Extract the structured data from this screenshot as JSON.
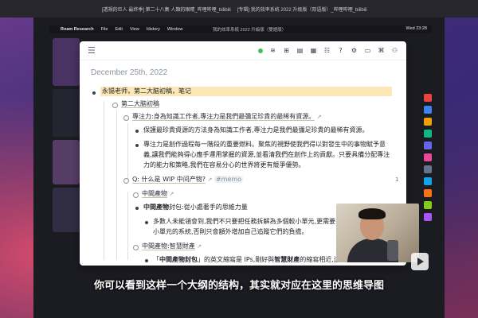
{
  "browser_tabs": [
    "[透視的巨人 最终季] 第二十八集 人類的眼睛_哔哩哔哩_bilibili",
    "[专辑] 我的效率系统 2022 升级版（双语版）_哔哩哔哩_bilibili"
  ],
  "menubar": {
    "apple": "",
    "app_name": "Roam Research",
    "items": [
      "File",
      "Edit",
      "View",
      "History",
      "Window"
    ],
    "window_title": "我的效率系統 2022 升級版（雙語版）",
    "clock": "Wed 23:28"
  },
  "roam": {
    "menu_icon": "☰",
    "tools": [
      "≋",
      "⊞",
      "▤",
      "▦",
      "☷",
      "?",
      "⚙",
      "▭",
      "⌘",
      "⚇"
    ],
    "date_title": "December 25th, 2022",
    "blocks": {
      "root": "永锡老师，第二大脑初稿，笔记",
      "l1": "第二大脑初稿",
      "l2a_ref": "專注力:身為知識工作者,專注力是我們最彌足珍貴的最稀有資源。",
      "l2a_arrow": "↗",
      "l3a": "保護最珍貴資源的方法身為知識工作者,專注力是我們最彌足珍貴的最稀有資源。",
      "l3b_line1": "專注力是創作過程每一階段的重要燃料。聚焦的視野使我們得以對發生中的事物賦予意",
      "l3b_line2": "義,讓我們能夠得心應手運用掌握的資源,並看清我們在創作上的貢獻。只要具備分配專注",
      "l3b_line3": "力的能力和策略,我們在容易分心的世界將更有競爭優勢。",
      "l2b": "Q: 什么是 WIP 中间产物?",
      "l2b_arrow": "↗",
      "l2b_tag": "#memo",
      "l2b_side_num": "1",
      "l3c": "中間產物",
      "l3c_arrow": "↗",
      "l3d_bold": "中間產物",
      "l3d_rest": "封包:從小處著手的思維力量",
      "l4a_line1": "多數人未能領會到,我們不只要把任務拆解為多個較小單元,更需要",
      "l4a_line2": "小單元的系統,否則只會額外增加自己追蹤它們的負擔。",
      "l3e": "中間產物:智慧財產",
      "l3e_arrow": "↗",
      "l4b_q": "「",
      "l4b_bold": "中間產物封包",
      "l4b_mid": "」的英文縮寫是 IPs,剛好與",
      "l4b_bold2": "智慧財產",
      "l4b_tail": "的縮寫相近,這是指知識的"
    }
  },
  "subtitle": "你可以看到这样一个大纲的结构，其实就对应在这里的思维导图",
  "colors": {
    "highlight": "#fde7b6",
    "status_dot": "#40c057",
    "link": "#3d6fb8"
  }
}
